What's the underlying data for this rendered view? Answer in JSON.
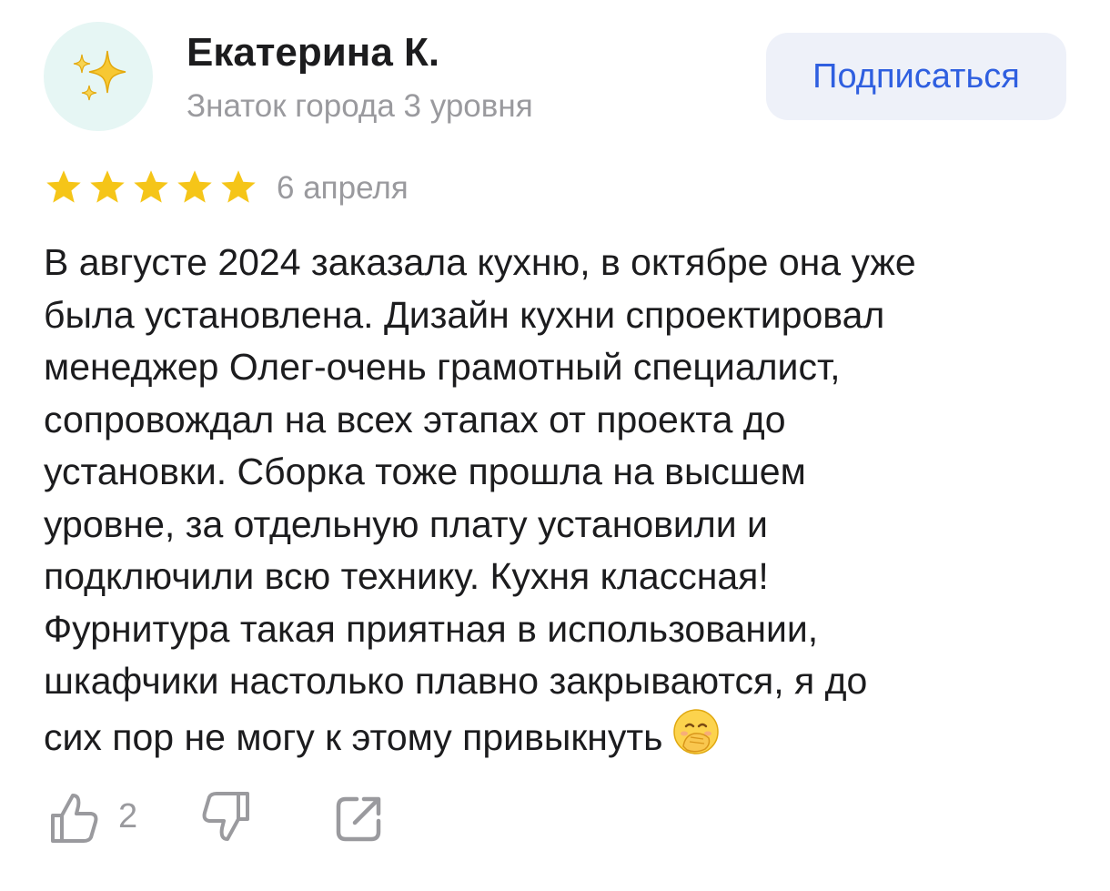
{
  "author": {
    "name": "Екатерина К.",
    "status": "Знаток города 3 уровня",
    "avatar_icon": "sparkles-icon",
    "avatar_bg": "#e6f6f4"
  },
  "subscribe": {
    "label": "Подписаться",
    "color": "#2f5fe0",
    "bg": "#eef1f9"
  },
  "review": {
    "rating": 5,
    "rating_max": 5,
    "star_color": "#f5c518",
    "date": "6 апреля",
    "lines": [
      "В августе 2024 заказала кухню, в октябре она уже",
      "была установлена. Дизайн кухни спроектировал",
      "менеджер Олег-очень грамотный специалист,",
      "сопровождал на всех этапах от проекта до",
      "установки. Сборка тоже прошла на высшем",
      "уровне, за отдельную плату установили и",
      "подключили всю технику. Кухня классная!",
      "Фурнитура такая приятная в использовании,",
      "шкафчики настолько плавно закрываются, я до",
      "сих пор не могу к этому привыкнуть"
    ],
    "trailing_emoji": "face-with-hand-over-mouth-icon"
  },
  "actions": {
    "like_count": "2",
    "like_icon": "thumbs-up-icon",
    "dislike_icon": "thumbs-down-icon",
    "share_icon": "share-icon",
    "icon_color": "#9a9a9e"
  }
}
